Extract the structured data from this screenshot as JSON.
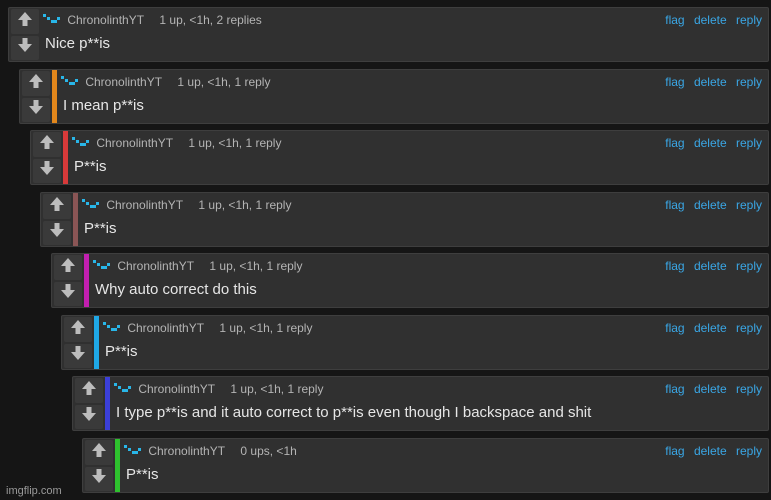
{
  "accent_link_color": "#3aa7e6",
  "watermark": "imgflip.com",
  "actions": {
    "flag": "flag",
    "delete": "delete",
    "reply": "reply"
  },
  "comments": [
    {
      "username": "ChronolinthYT",
      "stats": "1 up, <1h, 2 replies",
      "text": "Nice p**is",
      "depth_color": ""
    },
    {
      "username": "ChronolinthYT",
      "stats": "1 up, <1h, 1 reply",
      "text": "I mean p**is",
      "depth_color": "#e2871c"
    },
    {
      "username": "ChronolinthYT",
      "stats": "1 up, <1h, 1 reply",
      "text": "P**is",
      "depth_color": "#d73a3a"
    },
    {
      "username": "ChronolinthYT",
      "stats": "1 up, <1h, 1 reply",
      "text": "P**is",
      "depth_color": "#8a5555"
    },
    {
      "username": "ChronolinthYT",
      "stats": "1 up, <1h, 1 reply",
      "text": "Why auto correct do this",
      "depth_color": "#c21fb0"
    },
    {
      "username": "ChronolinthYT",
      "stats": "1 up, <1h, 1 reply",
      "text": "P**is",
      "depth_color": "#1fa8e6"
    },
    {
      "username": "ChronolinthYT",
      "stats": "1 up, <1h, 1 reply",
      "text": "I type p**is and it auto correct to p**is even though I backspace and shit",
      "depth_color": "#3b3fd8"
    },
    {
      "username": "ChronolinthYT",
      "stats": "0 ups, <1h",
      "text": "P**is",
      "depth_color": "#2ec22e"
    }
  ]
}
